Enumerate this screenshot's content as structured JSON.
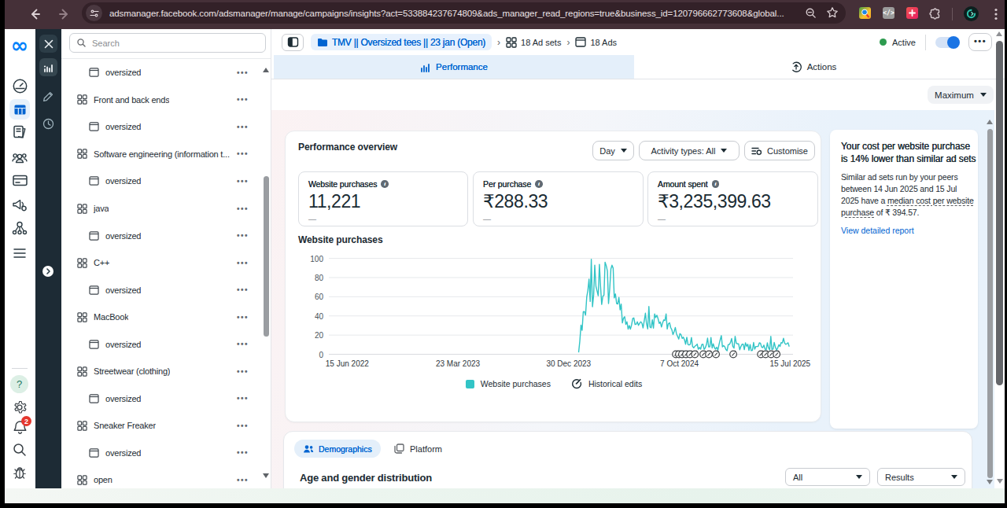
{
  "browser": {
    "url": "adsmanager.facebook.com/adsmanager/manage/campaigns/insights?act=533884237674809&ads_manager_read_regions=true&business_id=120796662773608&global...",
    "menu_dots": "⋮"
  },
  "nav_rail": {
    "items": [
      "account-overview",
      "campaigns",
      "ads-reporting",
      "audiences",
      "billing",
      "advertising-settings",
      "business-apps",
      "all-tools"
    ],
    "active_item": "campaigns",
    "logo_glyph": "∞",
    "help_glyph": "?",
    "notification_count": "2"
  },
  "tool_rail": {
    "items": [
      "close",
      "insights",
      "edit",
      "recent"
    ],
    "active_item": "insights"
  },
  "tree": {
    "search_placeholder": "Search",
    "items": [
      {
        "type": "ad",
        "label": "oversized"
      },
      {
        "type": "adset",
        "label": "Front and back ends"
      },
      {
        "type": "ad",
        "label": "oversized"
      },
      {
        "type": "adset",
        "label": "Software engineering (information t..."
      },
      {
        "type": "ad",
        "label": "oversized"
      },
      {
        "type": "adset",
        "label": "java"
      },
      {
        "type": "ad",
        "label": "oversized"
      },
      {
        "type": "adset",
        "label": "C++"
      },
      {
        "type": "ad",
        "label": "oversized"
      },
      {
        "type": "adset",
        "label": "MacBook"
      },
      {
        "type": "ad",
        "label": "oversized"
      },
      {
        "type": "adset",
        "label": "Streetwear (clothing)"
      },
      {
        "type": "ad",
        "label": "oversized"
      },
      {
        "type": "adset",
        "label": "Sneaker Freaker"
      },
      {
        "type": "ad",
        "label": "oversized"
      },
      {
        "type": "adset",
        "label": "open"
      }
    ],
    "row_menu": "•••"
  },
  "header": {
    "breadcrumb": {
      "campaign": "TMV || Oversized tees || 23 jan (Open)",
      "adsets": "18 Ad sets",
      "ads": "18 Ads",
      "separator": "›"
    },
    "status_label": "Active",
    "toggle_on": true,
    "more_label": "•••"
  },
  "tabs": {
    "performance": "Performance",
    "actions": "Actions"
  },
  "view_controls": {
    "maximum": "Maximum"
  },
  "overview": {
    "title": "Performance overview",
    "controls": {
      "day": "Day",
      "activity": "Activity types: All",
      "customise": "Customise"
    },
    "info_glyph": "i",
    "metrics": [
      {
        "label": "Website purchases",
        "value": "11,221",
        "sub": "—"
      },
      {
        "label": "Per purchase",
        "value": "₹288.33",
        "sub": "—"
      },
      {
        "label": "Amount spent",
        "value": "₹3,235,399.63",
        "sub": "—"
      }
    ],
    "chart_title": "Website purchases"
  },
  "chart_data": {
    "type": "line",
    "title": "Website purchases",
    "xlabel": "",
    "ylabel": "",
    "x_ticks": [
      "15 Jun 2022",
      "23 Mar 2023",
      "30 Dec 2023",
      "7 Oct 2024",
      "15 Jul 2025"
    ],
    "y_ticks": [
      0,
      20,
      40,
      60,
      80,
      100
    ],
    "ylim": [
      0,
      100
    ],
    "grid": true,
    "legend_position": "bottom",
    "line_color": "#32c4c6",
    "legend": [
      "Website purchases",
      "Historical edits"
    ],
    "series": [
      {
        "name": "Website purchases",
        "points": [
          [
            0.5226,
            2
          ],
          [
            0.5252,
            13.6
          ],
          [
            0.5278,
            30.4
          ],
          [
            0.5304,
            25.0
          ],
          [
            0.533,
            44.3
          ],
          [
            0.5356,
            44.6
          ],
          [
            0.5382,
            40.8
          ],
          [
            0.5408,
            59.7
          ],
          [
            0.5434,
            66.4
          ],
          [
            0.546,
            78.3
          ],
          [
            0.5486,
            55
          ],
          [
            0.5512,
            99
          ],
          [
            0.5538,
            49.5
          ],
          [
            0.5564,
            62
          ],
          [
            0.559,
            93
          ],
          [
            0.5616,
            70.9
          ],
          [
            0.5642,
            66.1
          ],
          [
            0.5668,
            61.1
          ],
          [
            0.5694,
            93.8
          ],
          [
            0.572,
            71.7
          ],
          [
            0.5746,
            52
          ],
          [
            0.5772,
            60.6
          ],
          [
            0.5798,
            61.5
          ],
          [
            0.5823,
            96
          ],
          [
            0.5849,
            92.3
          ],
          [
            0.5875,
            86.8
          ],
          [
            0.5901,
            52.9
          ],
          [
            0.5927,
            68.1
          ],
          [
            0.5953,
            88.9
          ],
          [
            0.5979,
            92.9
          ],
          [
            0.6005,
            89.7
          ],
          [
            0.6031,
            58.7
          ],
          [
            0.6057,
            62.9
          ],
          [
            0.6083,
            52.9
          ],
          [
            0.6109,
            52.4
          ],
          [
            0.6135,
            59.3
          ],
          [
            0.6161,
            46.3
          ],
          [
            0.6187,
            52.3
          ],
          [
            0.6213,
            32.7
          ],
          [
            0.6239,
            37.6
          ],
          [
            0.6265,
            39.2
          ],
          [
            0.6291,
            31.1
          ],
          [
            0.6317,
            33.9
          ],
          [
            0.6343,
            26.2
          ],
          [
            0.6369,
            29.9
          ],
          [
            0.6395,
            26.2
          ],
          [
            0.6421,
            30.6
          ],
          [
            0.6447,
            37.3
          ],
          [
            0.6473,
            37.9
          ],
          [
            0.6499,
            31.2
          ],
          [
            0.6525,
            31.4
          ],
          [
            0.6551,
            33.9
          ],
          [
            0.6577,
            30.2
          ],
          [
            0.6603,
            32.2
          ],
          [
            0.6629,
            33.9
          ],
          [
            0.6655,
            32.2
          ],
          [
            0.6681,
            27.5
          ],
          [
            0.6707,
            34.9
          ],
          [
            0.6733,
            42.8
          ],
          [
            0.6759,
            31.8
          ],
          [
            0.6785,
            26.5
          ],
          [
            0.6811,
            49.8
          ],
          [
            0.6837,
            28.3
          ],
          [
            0.6863,
            27.6
          ],
          [
            0.6889,
            36.0
          ],
          [
            0.6915,
            27.3
          ],
          [
            0.6941,
            42.1
          ],
          [
            0.6967,
            38.3
          ],
          [
            0.6993,
            40.7
          ],
          [
            0.7018,
            37.3
          ],
          [
            0.7044,
            32.2
          ],
          [
            0.707,
            33.7
          ],
          [
            0.7096,
            28.4
          ],
          [
            0.7122,
            32.9
          ],
          [
            0.7148,
            35.8
          ],
          [
            0.7174,
            35.2
          ],
          [
            0.72,
            42.1
          ],
          [
            0.7226,
            26.3
          ],
          [
            0.7252,
            31.8
          ],
          [
            0.7278,
            32.8
          ],
          [
            0.7304,
            27.9
          ],
          [
            0.733,
            25.5
          ],
          [
            0.7356,
            20.6
          ],
          [
            0.7382,
            23.6
          ],
          [
            0.7408,
            28.0
          ],
          [
            0.7434,
            21.6
          ],
          [
            0.746,
            18.7
          ],
          [
            0.7486,
            15.8
          ],
          [
            0.7512,
            21.5
          ],
          [
            0.7538,
            20.4
          ],
          [
            0.7564,
            16.5
          ],
          [
            0.759,
            17.9
          ],
          [
            0.7616,
            14.9
          ],
          [
            0.7642,
            10.5
          ],
          [
            0.7668,
            17.7
          ],
          [
            0.7694,
            10.2
          ],
          [
            0.772,
            9.7
          ],
          [
            0.7746,
            10.3
          ],
          [
            0.7772,
            17.5
          ],
          [
            0.7798,
            8.2
          ],
          [
            0.7824,
            6.7
          ],
          [
            0.785,
            8.4
          ],
          [
            0.7876,
            9.2
          ],
          [
            0.7902,
            10.6
          ],
          [
            0.7928,
            5.3
          ],
          [
            0.7954,
            7.1
          ],
          [
            0.798,
            5.3
          ],
          [
            0.8006,
            10.1
          ],
          [
            0.8032,
            10.6
          ],
          [
            0.8058,
            5.2
          ],
          [
            0.8084,
            6.6
          ],
          [
            0.811,
            10.0
          ],
          [
            0.8136,
            16.8
          ],
          [
            0.8162,
            7.7
          ],
          [
            0.8188,
            7.8
          ],
          [
            0.8213,
            17.5
          ],
          [
            0.8239,
            6.6
          ],
          [
            0.8265,
            11.0
          ],
          [
            0.8291,
            7.0
          ],
          [
            0.8317,
            5.3
          ],
          [
            0.8343,
            7.4
          ],
          [
            0.8369,
            4.3
          ],
          [
            0.8395,
            10.0
          ],
          [
            0.8421,
            15.0
          ],
          [
            0.8447,
            19.4
          ],
          [
            0.8473,
            7.7
          ],
          [
            0.8499,
            9.0
          ],
          [
            0.8525,
            7.8
          ],
          [
            0.8551,
            4.9
          ],
          [
            0.8577,
            3.7
          ],
          [
            0.8603,
            10.0
          ],
          [
            0.8629,
            10.2
          ],
          [
            0.8655,
            12.4
          ],
          [
            0.8681,
            16.4
          ],
          [
            0.8707,
            8.0
          ],
          [
            0.8733,
            6.4
          ],
          [
            0.8759,
            18.7
          ],
          [
            0.8785,
            11.6
          ],
          [
            0.8811,
            10.8
          ],
          [
            0.8837,
            10.9
          ],
          [
            0.8863,
            4.7
          ],
          [
            0.8889,
            8.1
          ],
          [
            0.8915,
            10.5
          ],
          [
            0.8941,
            10.5
          ],
          [
            0.8967,
            4.8
          ],
          [
            0.8993,
            12.0
          ],
          [
            0.9019,
            8.3
          ],
          [
            0.9045,
            10.5
          ],
          [
            0.9071,
            4.0
          ],
          [
            0.9097,
            10.1
          ],
          [
            0.9123,
            3.8
          ],
          [
            0.9149,
            4.1
          ],
          [
            0.9175,
            12.3
          ],
          [
            0.9201,
            5.3
          ],
          [
            0.9227,
            8.1
          ],
          [
            0.9253,
            8.1
          ],
          [
            0.9279,
            8.2
          ],
          [
            0.9305,
            11.9
          ],
          [
            0.9331,
            11.5
          ],
          [
            0.9357,
            7.5
          ],
          [
            0.9383,
            7.0
          ],
          [
            0.9408,
            9.5
          ],
          [
            0.9434,
            5.4
          ],
          [
            0.946,
            4.6
          ],
          [
            0.9486,
            12.0
          ],
          [
            0.9512,
            6.8
          ],
          [
            0.9538,
            4.7
          ],
          [
            0.9564,
            18.6
          ],
          [
            0.959,
            5.0
          ],
          [
            0.9616,
            5.5
          ],
          [
            0.9642,
            12.4
          ],
          [
            0.9668,
            7.3
          ],
          [
            0.9694,
            4.3
          ],
          [
            0.972,
            6.5
          ],
          [
            0.9746,
            9.8
          ],
          [
            0.9772,
            8.2
          ],
          [
            0.9798,
            12.1
          ],
          [
            0.9824,
            11.8
          ],
          [
            0.985,
            16.7
          ],
          [
            0.9876,
            11.7
          ],
          [
            0.9902,
            10.3
          ],
          [
            0.9928,
            11.1
          ],
          [
            0.9954,
            12.0
          ],
          [
            0.998,
            8
          ]
        ]
      }
    ],
    "historical_edits": [
      0.742,
      0.749,
      0.756,
      0.765,
      0.774,
      0.785,
      0.804,
      0.8166,
      0.8326,
      0.8717,
      0.934,
      0.9446,
      0.957,
      0.9695
    ]
  },
  "insight": {
    "title_line1": "Your cost per website purchase",
    "title_line2": "is 14% lower than similar ad sets",
    "body_line1": "Similar ad sets run by your peers",
    "body_line2": "between 14 Jun 2025 and 15 Jul",
    "body_line3_plain": "2025 have a ",
    "body_line3_underlined": "median cost per website",
    "body_line4_underlined": "purchase",
    "body_line4_plain": " of ₹ 394.57.",
    "link": "View detailed report"
  },
  "demographics": {
    "tab_demographics": "Demographics",
    "tab_platform": "Platform",
    "heading": "Age and gender distribution",
    "filter_all": "All",
    "filter_results": "Results"
  }
}
